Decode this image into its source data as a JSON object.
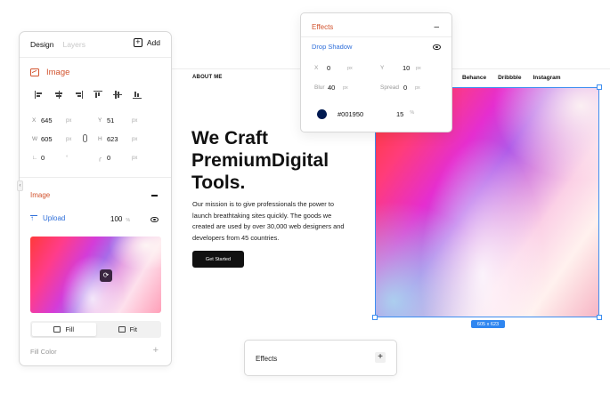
{
  "site": {
    "about": "ABOUT ME",
    "nav": [
      "Behance",
      "Dribbble",
      "Instagram"
    ],
    "headline": "We Craft PremiumDigital Tools.",
    "mission": "Our mission is to give professionals the power to launch breathtaking sites quickly. The goods we created are used by over 30,000 web designers and developers from 45 countries.",
    "cta": "Get Started",
    "size_badge": "605 x 623"
  },
  "panel": {
    "tab_design": "Design",
    "tab_layers": "Layers",
    "add_label": "Add",
    "section_title": "Image",
    "x_label": "X",
    "x_value": "645",
    "x_unit": "px",
    "y_label": "Y",
    "y_value": "51",
    "y_unit": "px",
    "w_label": "W",
    "w_value": "605",
    "w_unit": "px",
    "h_label": "H",
    "h_value": "623",
    "h_unit": "px",
    "angle_value": "0",
    "angle_unit": "°",
    "radius_value": "0",
    "radius_unit": "px",
    "image_section": "Image",
    "upload_label": "Upload",
    "opacity_value": "100",
    "opacity_unit": "%",
    "fill_label": "Fill",
    "fit_label": "Fit",
    "fill_color_label": "Fill Color",
    "fill_color_add": "+"
  },
  "effects": {
    "title": "Effects",
    "collapse": "–",
    "drop_shadow": "Drop Shadow",
    "x_label": "X",
    "x_value": "0",
    "x_unit": "px",
    "y_label": "Y",
    "y_value": "10",
    "y_unit": "px",
    "blur_label": "Blur",
    "blur_value": "40",
    "blur_unit": "px",
    "spread_label": "Spread",
    "spread_value": "0",
    "spread_unit": "px",
    "color_hex": "#001950",
    "opacity_value": "15",
    "opacity_unit": "%"
  },
  "effects_bottom": {
    "title": "Effects",
    "add": "+"
  },
  "colors": {
    "accent_orange": "#d2532e",
    "link_blue": "#2f6fda",
    "selection_blue": "#3d8ef0",
    "shadow_color": "#001950"
  }
}
